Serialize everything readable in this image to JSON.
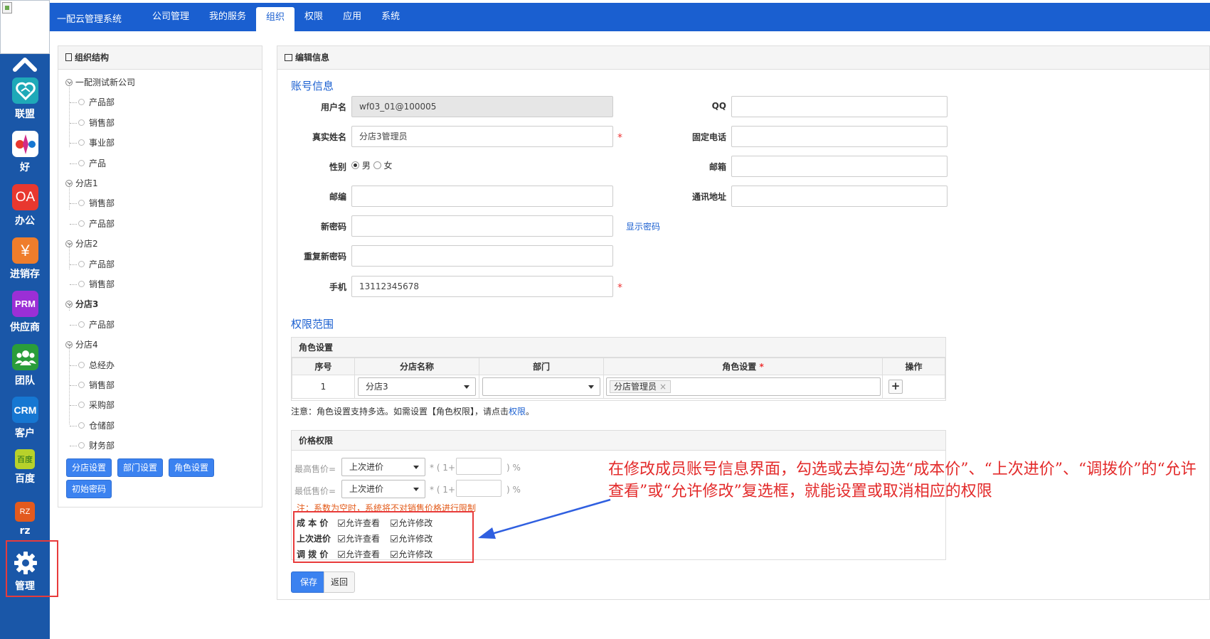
{
  "sidebar": {
    "items": [
      {
        "label": "联盟",
        "icon": "heart-handshake-icon",
        "color": "#1fa9b8"
      },
      {
        "label": "好",
        "icon": "multicolor-app-icon",
        "color": "#ffffff"
      },
      {
        "label": "办公",
        "icon": "oa-icon",
        "text": "OA",
        "color": "#e8382f"
      },
      {
        "label": "进销存",
        "icon": "yen-icon",
        "text": "¥",
        "color": "#ef7d2b"
      },
      {
        "label": "供应商",
        "icon": "prm-icon",
        "text": "PRM",
        "color": "#9b2fd6"
      },
      {
        "label": "团队",
        "icon": "team-icon",
        "color": "#2a9d3a"
      },
      {
        "label": "客户",
        "icon": "crm-icon",
        "text": "CRM",
        "color": "#1677d2"
      },
      {
        "label": "百度",
        "icon": "baidu-icon",
        "text": "百度",
        "color": "#b7d12b"
      },
      {
        "label": "rz",
        "icon": "rz-icon",
        "text": "RZ",
        "color": "#e35a1e"
      },
      {
        "label": "管理",
        "icon": "gear-icon",
        "color": "#ffffff"
      }
    ]
  },
  "header": {
    "brand": "一配云管理系统",
    "tabs": [
      "公司管理",
      "我的服务",
      "组织",
      "权限",
      "应用",
      "系统"
    ],
    "active_tab": "组织"
  },
  "org": {
    "title": "组织结构",
    "tree": [
      {
        "label": "一配测试新公司",
        "level": 0
      },
      {
        "label": "产品部",
        "level": 1
      },
      {
        "label": "销售部",
        "level": 1
      },
      {
        "label": "事业部",
        "level": 1
      },
      {
        "label": "产品",
        "level": 1
      },
      {
        "label": "分店1",
        "level": 0
      },
      {
        "label": "销售部",
        "level": 1
      },
      {
        "label": "产品部",
        "level": 1
      },
      {
        "label": "分店2",
        "level": 0
      },
      {
        "label": "产品部",
        "level": 1
      },
      {
        "label": "销售部",
        "level": 1
      },
      {
        "label": "分店3",
        "level": 0,
        "bold": true
      },
      {
        "label": "产品部",
        "level": 1
      },
      {
        "label": "分店4",
        "level": 0
      },
      {
        "label": "总经办",
        "level": 1
      },
      {
        "label": "销售部",
        "level": 1
      },
      {
        "label": "采购部",
        "level": 1
      },
      {
        "label": "仓储部",
        "level": 1
      },
      {
        "label": "财务部",
        "level": 1
      }
    ],
    "buttons": [
      "分店设置",
      "部门设置",
      "角色设置",
      "初始密码"
    ]
  },
  "edit": {
    "title": "编辑信息",
    "account_section": "账号信息",
    "fields": {
      "username": {
        "label": "用户名",
        "value": "wf03_01@100005"
      },
      "realname": {
        "label": "真实姓名",
        "value": "分店3管理员"
      },
      "gender": {
        "label": "性别",
        "male": "男",
        "female": "女",
        "selected": "男"
      },
      "zipcode": {
        "label": "邮编",
        "value": ""
      },
      "newpwd": {
        "label": "新密码",
        "value": ""
      },
      "repwd": {
        "label": "重复新密码",
        "value": ""
      },
      "mobile": {
        "label": "手机",
        "value": "13112345678"
      },
      "qq": {
        "label": "QQ",
        "value": ""
      },
      "phone": {
        "label": "固定电话",
        "value": ""
      },
      "email": {
        "label": "邮箱",
        "value": ""
      },
      "address": {
        "label": "通讯地址",
        "value": ""
      }
    },
    "required_mark": "*",
    "show_password": "显示密码",
    "perm_section": "权限范围",
    "role_box": {
      "title": "角色设置",
      "columns": [
        "序号",
        "分店名称",
        "部门",
        "角色设置",
        "操作"
      ],
      "row": {
        "index": "1",
        "store": "分店3",
        "dept": "",
        "role_tag": "分店管理员",
        "remove": "×",
        "add": "+"
      }
    },
    "note_prefix": "注意：角色设置支持多选。如需设置【角色权限】，请点击",
    "note_link": "权限",
    "note_suffix": "。",
    "price_box": {
      "title": "价格权限",
      "max_label": "最高售价=",
      "min_label": "最低售价=",
      "select_value": "上次进价",
      "formula_mid": "* ( 1+",
      "formula_end": ") %",
      "warning": "注：系数为空时，系统将不对销售价格进行限制",
      "rows": [
        {
          "label": "成 本 价",
          "view": "允许查看",
          "edit": "允许修改",
          "view_checked": true,
          "edit_checked": true
        },
        {
          "label": "上次进价",
          "view": "允许查看",
          "edit": "允许修改",
          "view_checked": true,
          "edit_checked": true
        },
        {
          "label": "调 拨 价",
          "view": "允许查看",
          "edit": "允许修改",
          "view_checked": true,
          "edit_checked": true
        }
      ]
    },
    "save": "保存",
    "back": "返回"
  },
  "annotation": "在修改成员账号信息界面，勾选或去掉勾选“成本价”、“上次进价”、“调拨价”的“允许查看”或“允许修改”复选框，就能设置或取消相应的权限",
  "colors": {
    "topbar": "#1a5fd0",
    "sidebar": "#1a57a8",
    "highlight": "#e83b3b",
    "link": "#1a5fd0"
  }
}
